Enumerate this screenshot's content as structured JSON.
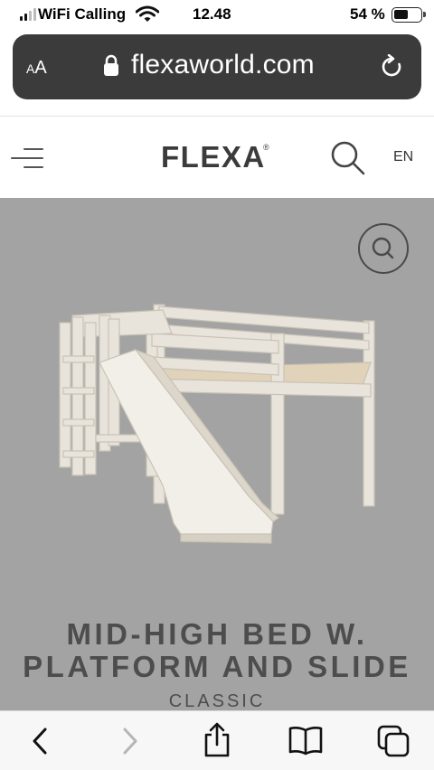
{
  "status_bar": {
    "carrier": "WiFi Calling",
    "time": "12.48",
    "battery_percent": "54 %",
    "battery_level": 0.54,
    "signal_bars": 2
  },
  "address_bar": {
    "text_size_label_small": "A",
    "text_size_label_large": "A",
    "url": "flexaworld.com"
  },
  "site_header": {
    "logo": "FLEXA",
    "registered_mark": "®",
    "language": "EN"
  },
  "product": {
    "title_line1": "MID-HIGH BED W.",
    "title_line2": "PLATFORM AND SLIDE",
    "collection": "CLASSIC",
    "image_subject": "white wooden mid-high bed with platform, ladder and slide"
  },
  "toolbar": {
    "icons": [
      "back-icon",
      "forward-icon",
      "share-icon",
      "bookmarks-icon",
      "tabs-icon"
    ]
  },
  "colors": {
    "address_bar_bg": "#3b3b3b",
    "product_bg": "#a3a3a3",
    "title_text": "#4d4d4d",
    "toolbar_bg": "#f7f7f7",
    "forward_disabled": "#b5b5b5"
  }
}
